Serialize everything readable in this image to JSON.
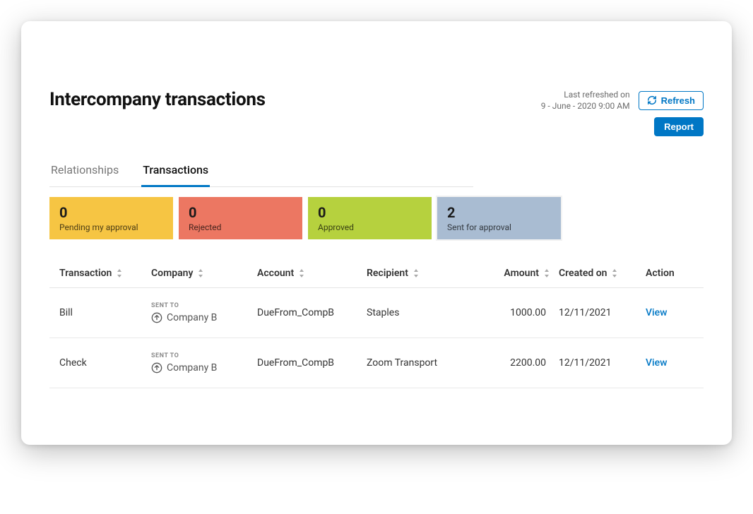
{
  "header": {
    "title": "Intercompany transactions",
    "last_refreshed_label": "Last refreshed on",
    "last_refreshed_value": "9 - June - 2020 9:00 AM",
    "refresh_button": "Refresh",
    "report_button": "Report"
  },
  "tabs": {
    "relationships": "Relationships",
    "transactions": "Transactions"
  },
  "stats": {
    "pending": {
      "value": "0",
      "label": "Pending my approval"
    },
    "rejected": {
      "value": "0",
      "label": "Rejected"
    },
    "approved": {
      "value": "0",
      "label": "Approved"
    },
    "sent": {
      "value": "2",
      "label": "Sent for approval"
    }
  },
  "table": {
    "columns": {
      "transaction": "Transaction",
      "company": "Company",
      "account": "Account",
      "recipient": "Recipient",
      "amount": "Amount",
      "created_on": "Created on",
      "action": "Action"
    },
    "sent_to_label": "SENT TO",
    "view_label": "View",
    "rows": [
      {
        "transaction": "Bill",
        "company": "Company B",
        "account": "DueFrom_CompB",
        "recipient": "Staples",
        "amount": "1000.00",
        "created_on": "12/11/2021"
      },
      {
        "transaction": "Check",
        "company": "Company B",
        "account": "DueFrom_CompB",
        "recipient": "Zoom Transport",
        "amount": "2200.00",
        "created_on": "12/11/2021"
      }
    ]
  }
}
